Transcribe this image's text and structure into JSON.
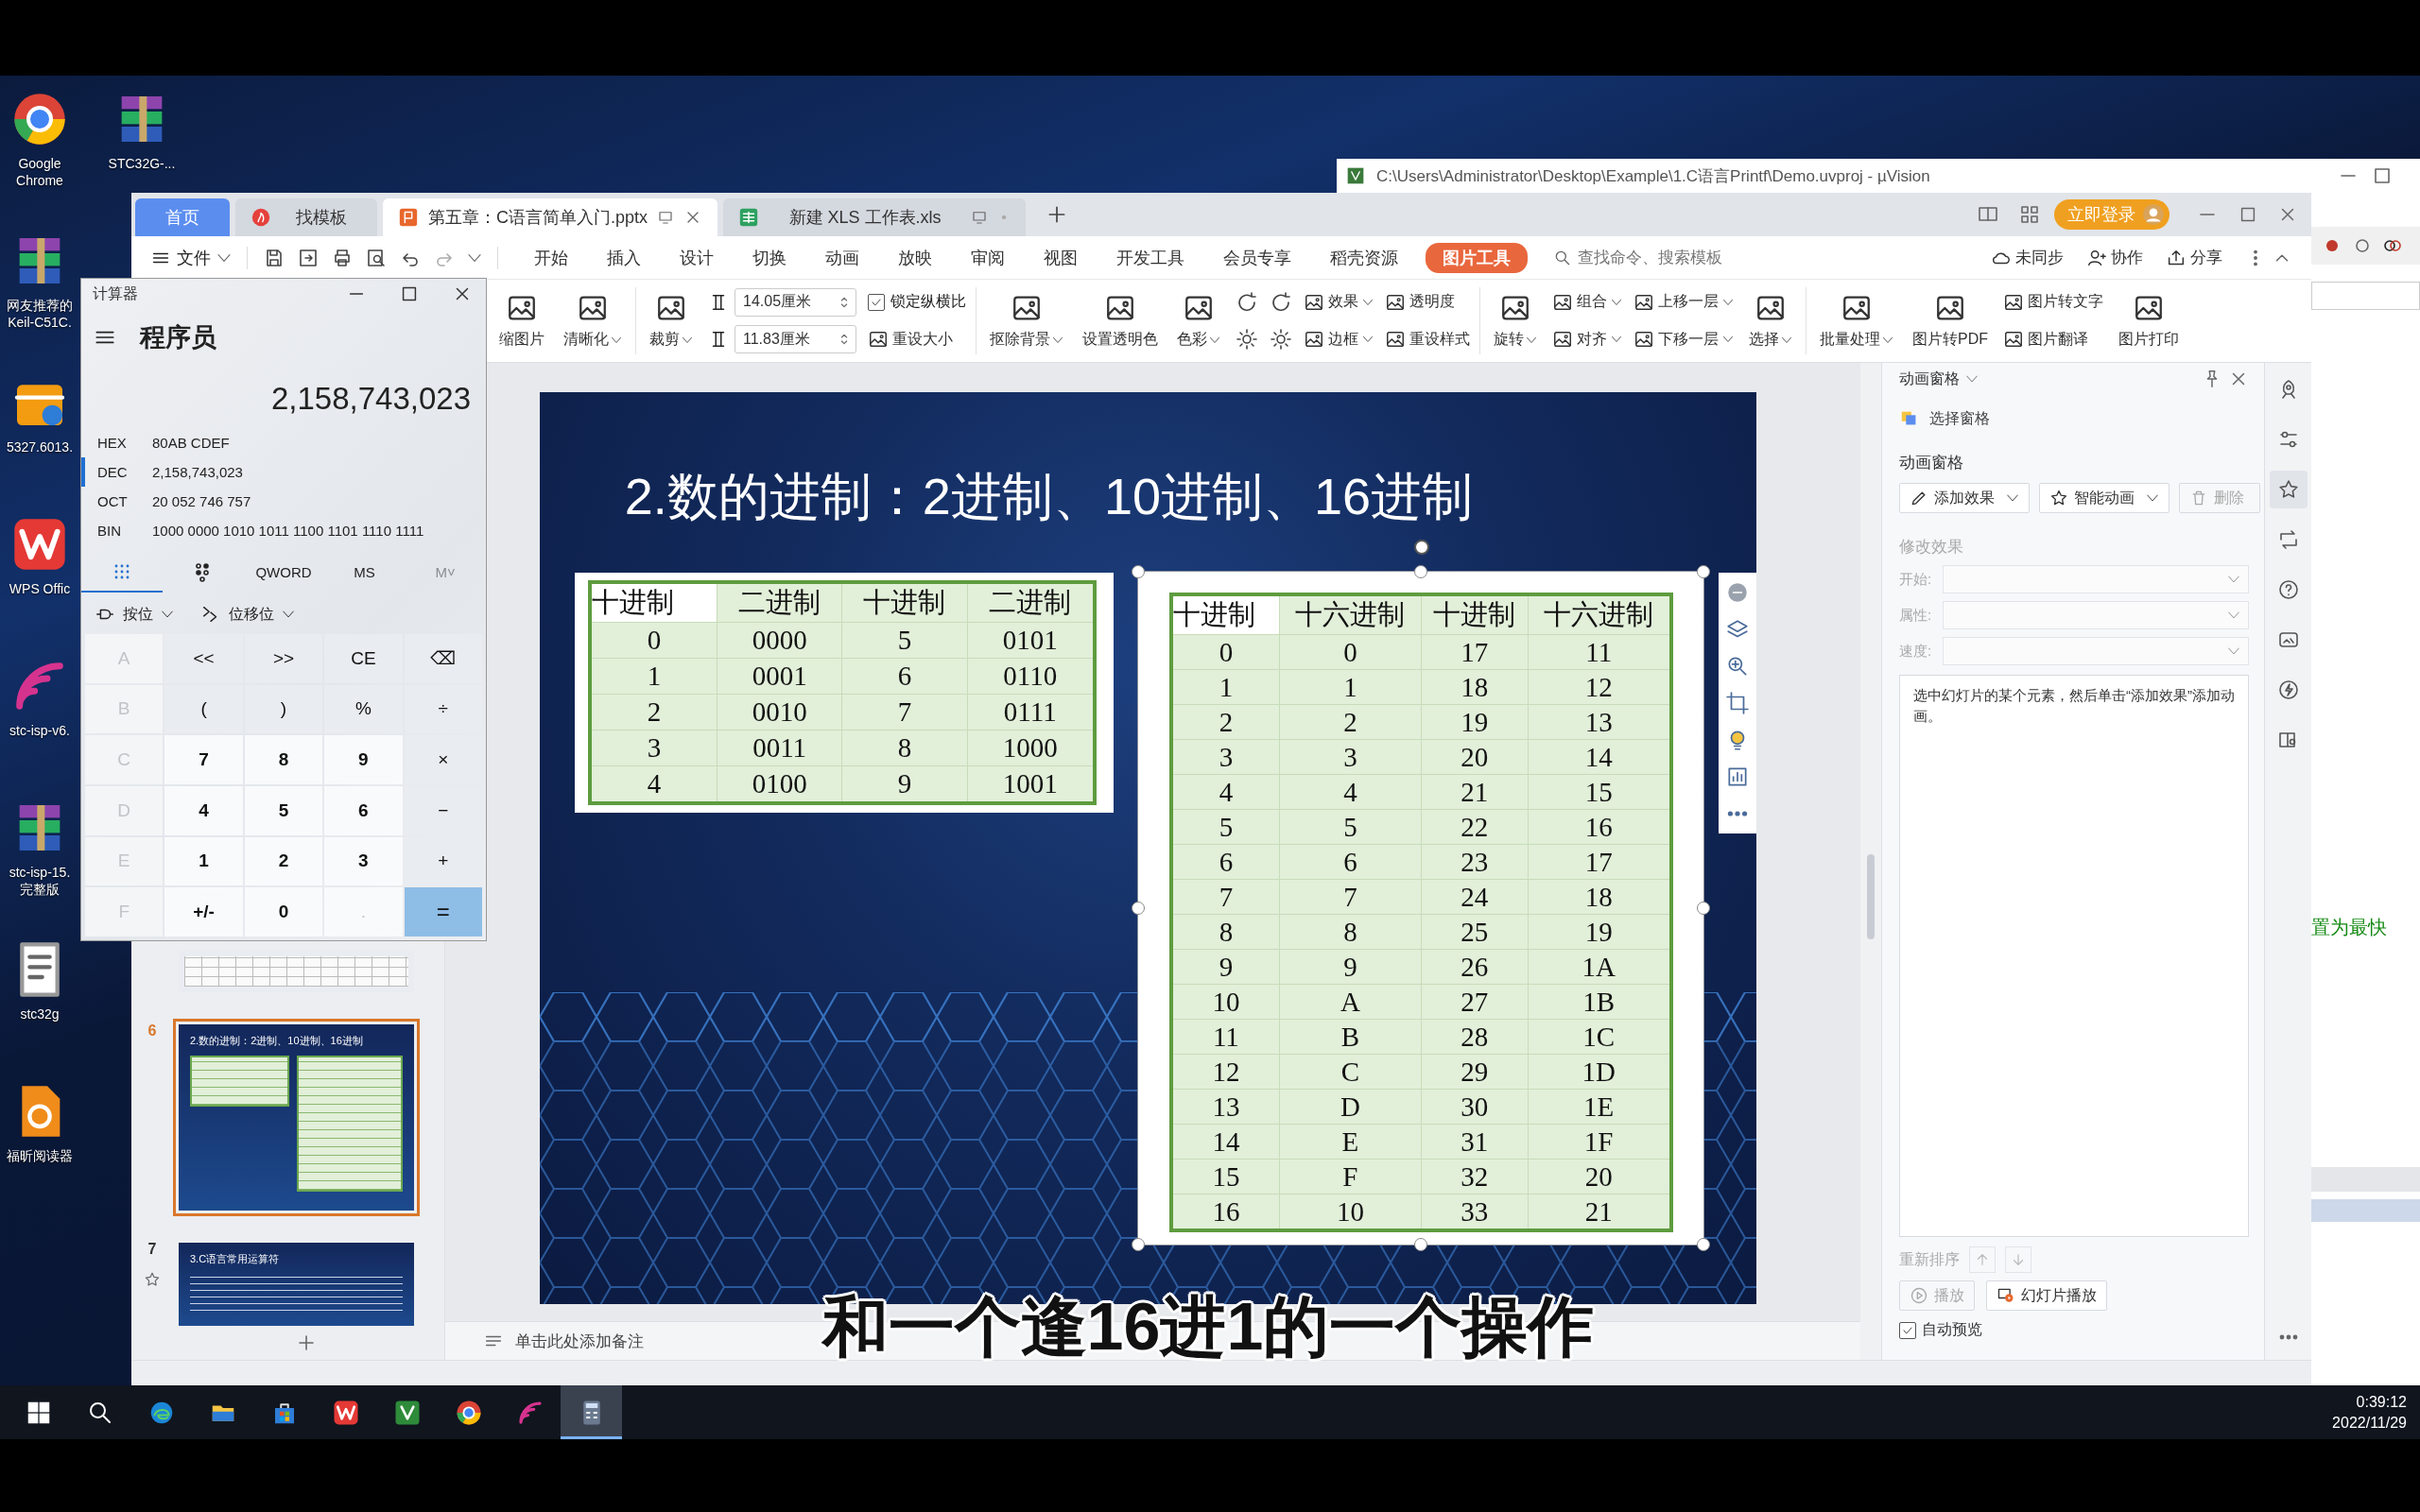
{
  "desktop": {
    "icons": [
      {
        "kind": "chrome",
        "lines": [
          "Google",
          "Chrome"
        ]
      },
      {
        "kind": "archive",
        "lines": [
          "网友推荐的",
          "Keil-C51C."
        ]
      },
      {
        "kind": "installer",
        "lines": [
          "5327.6013."
        ]
      },
      {
        "kind": "wps",
        "lines": [
          "WPS Offic"
        ]
      },
      {
        "kind": "isp",
        "lines": [
          "stc-isp-v6."
        ]
      },
      {
        "kind": "archive",
        "lines": [
          "stc-isp-15.",
          "完整版"
        ]
      },
      {
        "kind": "document",
        "lines": [
          "stc32g"
        ]
      },
      {
        "kind": "pdf",
        "lines": [
          "福昕阅读器"
        ]
      }
    ],
    "icons_column_2": [
      {
        "kind": "archive",
        "lines": [
          "STC32G-..."
        ]
      }
    ]
  },
  "background_window": {
    "title": "C:\\Users\\Administrator\\Desktop\\Example\\1.C语言Printf\\Demo.uvproj - µVision",
    "status_text": "置为最快"
  },
  "wps": {
    "tabs": [
      {
        "kind": "home",
        "label": "首页",
        "selected": false
      },
      {
        "kind": "template",
        "label": "找模板",
        "selected": false
      },
      {
        "kind": "presentation",
        "label": "第五章：C语言简单入门.pptx",
        "selected": true
      },
      {
        "kind": "sheet",
        "label": "新建 XLS 工作表.xls",
        "selected": false
      }
    ],
    "login_button": "立即登录",
    "file_menu": "文件",
    "menu_tabs": [
      {
        "label": "开始",
        "selected": false
      },
      {
        "label": "插入",
        "selected": false
      },
      {
        "label": "设计",
        "selected": false
      },
      {
        "label": "切换",
        "selected": false
      },
      {
        "label": "动画",
        "selected": false
      },
      {
        "label": "放映",
        "selected": false
      },
      {
        "label": "审阅",
        "selected": false
      },
      {
        "label": "视图",
        "selected": false
      },
      {
        "label": "开发工具",
        "selected": false
      },
      {
        "label": "会员专享",
        "selected": false
      },
      {
        "label": "稻壳资源",
        "selected": false
      },
      {
        "label": "图片工具",
        "selected": true
      }
    ],
    "search": {
      "placeholder": "查找命令、搜索模板"
    },
    "menu_actions": [
      {
        "kind": "cloud",
        "label": "未同步"
      },
      {
        "kind": "people",
        "label": "协作"
      },
      {
        "kind": "share",
        "label": "分享"
      }
    ],
    "ribbon": [
      {
        "columns": [
          [
            {
              "kind": "big",
              "label": "缩图片",
              "dropdown": false
            }
          ],
          [
            {
              "kind": "big",
              "label": "清晰化",
              "dropdown": true
            }
          ]
        ]
      },
      {
        "columns": [
          [
            {
              "kind": "big",
              "label": "裁剪",
              "dropdown": true
            }
          ],
          [
            {
              "kind": "field",
              "label": "14.05厘米"
            },
            {
              "kind": "field",
              "label": "11.83厘米"
            }
          ],
          [
            {
              "kind": "check",
              "label": "锁定纵横比",
              "checked": true
            },
            {
              "kind": "small",
              "label": "重设大小",
              "dropdown": false
            }
          ]
        ]
      },
      {
        "columns": [
          [
            {
              "kind": "big",
              "label": "抠除背景",
              "dropdown": true
            }
          ],
          [
            {
              "kind": "big",
              "label": "设置透明色",
              "dropdown": false
            }
          ],
          [
            {
              "kind": "big",
              "label": "色彩",
              "dropdown": true
            }
          ],
          [
            {
              "kind": "rotate"
            },
            {
              "kind": "brightness"
            }
          ],
          [
            {
              "kind": "rotate"
            },
            {
              "kind": "brightness"
            }
          ],
          [
            {
              "kind": "small",
              "label": "效果",
              "dropdown": true
            },
            {
              "kind": "small",
              "label": "边框",
              "dropdown": true
            }
          ],
          [
            {
              "kind": "small",
              "label": "透明度",
              "dropdown": false
            },
            {
              "kind": "small",
              "label": "重设样式",
              "dropdown": false
            }
          ]
        ]
      },
      {
        "columns": [
          [
            {
              "kind": "big",
              "label": "旋转",
              "dropdown": true
            }
          ],
          [
            {
              "kind": "small",
              "label": "组合",
              "dropdown": true
            },
            {
              "kind": "small",
              "label": "对齐",
              "dropdown": true
            }
          ],
          [
            {
              "kind": "small",
              "label": "上移一层",
              "dropdown": true
            },
            {
              "kind": "small",
              "label": "下移一层",
              "dropdown": true
            }
          ],
          [
            {
              "kind": "big",
              "label": "选择",
              "dropdown": true
            }
          ]
        ]
      },
      {
        "columns": [
          [
            {
              "kind": "big",
              "label": "批量处理",
              "dropdown": true
            }
          ],
          [
            {
              "kind": "big",
              "label": "图片转PDF",
              "dropdown": false
            }
          ],
          [
            {
              "kind": "small",
              "label": "图片转文字",
              "dropdown": false
            },
            {
              "kind": "small",
              "label": "图片翻译",
              "dropdown": false
            }
          ],
          [
            {
              "kind": "big",
              "label": "图片打印",
              "dropdown": false
            }
          ]
        ]
      }
    ],
    "thumbnails": [
      {
        "kind": "table",
        "selected": false,
        "starred": false
      },
      {
        "kind": "tables",
        "number": "6",
        "title": "2.数的进制：2进制、10进制、16进制",
        "selected": true,
        "starred": false
      },
      {
        "kind": "text",
        "number": "7",
        "title": "3.C语言常用运算符",
        "selected": false,
        "starred": true
      }
    ],
    "slide": {
      "title": "2.数的进制：2进制、10进制、16进制",
      "table_left": {
        "header": [
          "十进制",
          "二进制",
          "十进制",
          "二进制"
        ],
        "rows": [
          [
            "0",
            "0000",
            "5",
            "0101"
          ],
          [
            "1",
            "0001",
            "6",
            "0110"
          ],
          [
            "2",
            "0010",
            "7",
            "0111"
          ],
          [
            "3",
            "0011",
            "8",
            "1000"
          ],
          [
            "4",
            "0100",
            "9",
            "1001"
          ]
        ]
      },
      "table_right": {
        "selected": true,
        "header": [
          "十进制",
          "十六进制",
          "十进制",
          "十六进制"
        ],
        "rows": [
          [
            "0",
            "0",
            "17",
            "11"
          ],
          [
            "1",
            "1",
            "18",
            "12"
          ],
          [
            "2",
            "2",
            "19",
            "13"
          ],
          [
            "3",
            "3",
            "20",
            "14"
          ],
          [
            "4",
            "4",
            "21",
            "15"
          ],
          [
            "5",
            "5",
            "22",
            "16"
          ],
          [
            "6",
            "6",
            "23",
            "17"
          ],
          [
            "7",
            "7",
            "24",
            "18"
          ],
          [
            "8",
            "8",
            "25",
            "19"
          ],
          [
            "9",
            "9",
            "26",
            "1A"
          ],
          [
            "10",
            "A",
            "27",
            "1B"
          ],
          [
            "11",
            "B",
            "28",
            "1C"
          ],
          [
            "12",
            "C",
            "29",
            "1D"
          ],
          [
            "13",
            "D",
            "30",
            "1E"
          ],
          [
            "14",
            "E",
            "31",
            "1F"
          ],
          [
            "15",
            "F",
            "32",
            "20"
          ],
          [
            "16",
            "10",
            "33",
            "21"
          ]
        ]
      }
    },
    "notes_placeholder": "单击此处添加备注",
    "panel": {
      "title": "动画窗格",
      "selection_pane": "选择窗格",
      "section": "动画窗格",
      "buttons": [
        {
          "kind": "pen",
          "label": "添加效果",
          "dropdown": true,
          "disabled": false
        },
        {
          "kind": "star",
          "label": "智能动画",
          "dropdown": true,
          "disabled": false
        },
        {
          "kind": "trash",
          "label": "删除",
          "dropdown": false,
          "disabled": true
        }
      ],
      "modify": {
        "title": "修改效果",
        "disabled": true,
        "fields": [
          {
            "label": "开始:"
          },
          {
            "label": "属性:"
          },
          {
            "label": "速度:"
          }
        ]
      },
      "hint": "选中幻灯片的某个元素，然后单击“添加效果”添加动画。",
      "reorder_label": "重新排序",
      "play_buttons": [
        {
          "kind": "play",
          "label": "播放",
          "disabled": true
        },
        {
          "kind": "slideshow",
          "label": "幻灯片播放",
          "disabled": false
        }
      ],
      "auto_preview": {
        "label": "自动预览",
        "checked": true
      }
    },
    "side_strip": [
      {
        "kind": "rocket",
        "selected": false
      },
      {
        "kind": "sliders",
        "selected": false
      },
      {
        "kind": "star",
        "selected": true
      },
      {
        "kind": "loop",
        "selected": false
      },
      {
        "kind": "help",
        "selected": false
      },
      {
        "kind": "image",
        "selected": false
      },
      {
        "kind": "bolt",
        "selected": false
      },
      {
        "kind": "book",
        "selected": false
      }
    ]
  },
  "calculator": {
    "title": "计算器",
    "mode": "程序员",
    "display": "2,158,743,023",
    "bases": [
      {
        "name": "HEX",
        "value": "80AB CDEF",
        "selected": false
      },
      {
        "name": "DEC",
        "value": "2,158,743,023",
        "selected": true
      },
      {
        "name": "OCT",
        "value": "20 052 746 757",
        "selected": false
      },
      {
        "name": "BIN",
        "value": "1000 0000 1010 1011 1100 1101 1110 1111",
        "selected": false
      }
    ],
    "tabs": [
      {
        "kind": "keypad",
        "selected": true,
        "disabled": false
      },
      {
        "kind": "bits",
        "selected": false,
        "disabled": false
      },
      {
        "kind": "text",
        "label": "QWORD",
        "selected": false,
        "disabled": false
      },
      {
        "kind": "text",
        "label": "MS",
        "selected": false,
        "disabled": false
      },
      {
        "kind": "text",
        "label": "M˅",
        "selected": false,
        "disabled": true
      }
    ],
    "dropdowns": [
      {
        "kind": "bitwise",
        "label": "按位"
      },
      {
        "kind": "shift",
        "label": "位移位"
      }
    ],
    "keys": [
      {
        "label": "A",
        "kind": "letter",
        "disabled": true
      },
      {
        "label": "<<",
        "kind": "op",
        "disabled": false
      },
      {
        "label": ">>",
        "kind": "op",
        "disabled": false
      },
      {
        "label": "CE",
        "kind": "op",
        "disabled": false
      },
      {
        "label": "⌫",
        "kind": "op",
        "disabled": false
      },
      {
        "label": "B",
        "kind": "letter",
        "disabled": true
      },
      {
        "label": "(",
        "kind": "op",
        "disabled": false
      },
      {
        "label": ")",
        "kind": "op",
        "disabled": false
      },
      {
        "label": "%",
        "kind": "op",
        "disabled": false
      },
      {
        "label": "÷",
        "kind": "op",
        "disabled": false
      },
      {
        "label": "C",
        "kind": "letter",
        "disabled": true
      },
      {
        "label": "7",
        "kind": "num",
        "disabled": false
      },
      {
        "label": "8",
        "kind": "num",
        "disabled": false
      },
      {
        "label": "9",
        "kind": "num",
        "disabled": false
      },
      {
        "label": "×",
        "kind": "op",
        "disabled": false
      },
      {
        "label": "D",
        "kind": "letter",
        "disabled": true
      },
      {
        "label": "4",
        "kind": "num",
        "disabled": false
      },
      {
        "label": "5",
        "kind": "num",
        "disabled": false
      },
      {
        "label": "6",
        "kind": "num",
        "disabled": false
      },
      {
        "label": "−",
        "kind": "op",
        "disabled": false
      },
      {
        "label": "E",
        "kind": "letter",
        "disabled": true
      },
      {
        "label": "1",
        "kind": "num",
        "disabled": false
      },
      {
        "label": "2",
        "kind": "num",
        "disabled": false
      },
      {
        "label": "3",
        "kind": "num",
        "disabled": false
      },
      {
        "label": "+",
        "kind": "op",
        "disabled": false
      },
      {
        "label": "F",
        "kind": "letter",
        "disabled": true
      },
      {
        "label": "+/-",
        "kind": "num",
        "disabled": false
      },
      {
        "label": "0",
        "kind": "num",
        "disabled": false
      },
      {
        "label": ".",
        "kind": "num",
        "disabled": true
      },
      {
        "label": "=",
        "kind": "equals",
        "disabled": false
      }
    ]
  },
  "subtitle": "和一个逢16进1的一个操作",
  "taskbar": {
    "items": [
      {
        "kind": "start",
        "active": false
      },
      {
        "kind": "search",
        "active": false
      },
      {
        "kind": "edge",
        "active": false
      },
      {
        "kind": "files",
        "active": false
      },
      {
        "kind": "store",
        "active": false
      },
      {
        "kind": "wps",
        "active": false
      },
      {
        "kind": "keil",
        "active": false
      },
      {
        "kind": "chrome",
        "active": false
      },
      {
        "kind": "isp",
        "active": false
      },
      {
        "kind": "calculator",
        "active": true
      }
    ],
    "time": "0:39:12",
    "date": "2022/11/29"
  }
}
